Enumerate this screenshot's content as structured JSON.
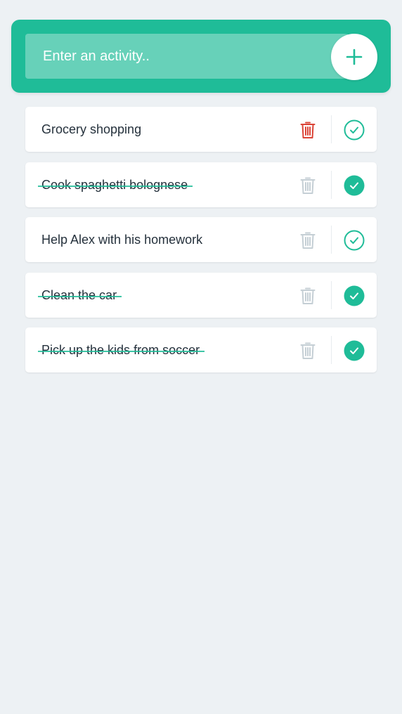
{
  "input": {
    "placeholder": "Enter an activity..",
    "value": ""
  },
  "colors": {
    "accent": "#1fbc98",
    "background": "#edf1f4",
    "delete_active": "#db4437",
    "delete_inactive": "#c5cfd5",
    "text": "#25313c"
  },
  "icons": {
    "add": "plus-icon",
    "delete": "trash-icon",
    "complete": "check-circle-icon"
  },
  "todos": [
    {
      "text": "Grocery shopping",
      "completed": false
    },
    {
      "text": "Cook spaghetti bolognese",
      "completed": true
    },
    {
      "text": "Help Alex with his homework",
      "completed": false
    },
    {
      "text": "Clean the car",
      "completed": true
    },
    {
      "text": "Pick up the kids from soccer",
      "completed": true
    }
  ]
}
